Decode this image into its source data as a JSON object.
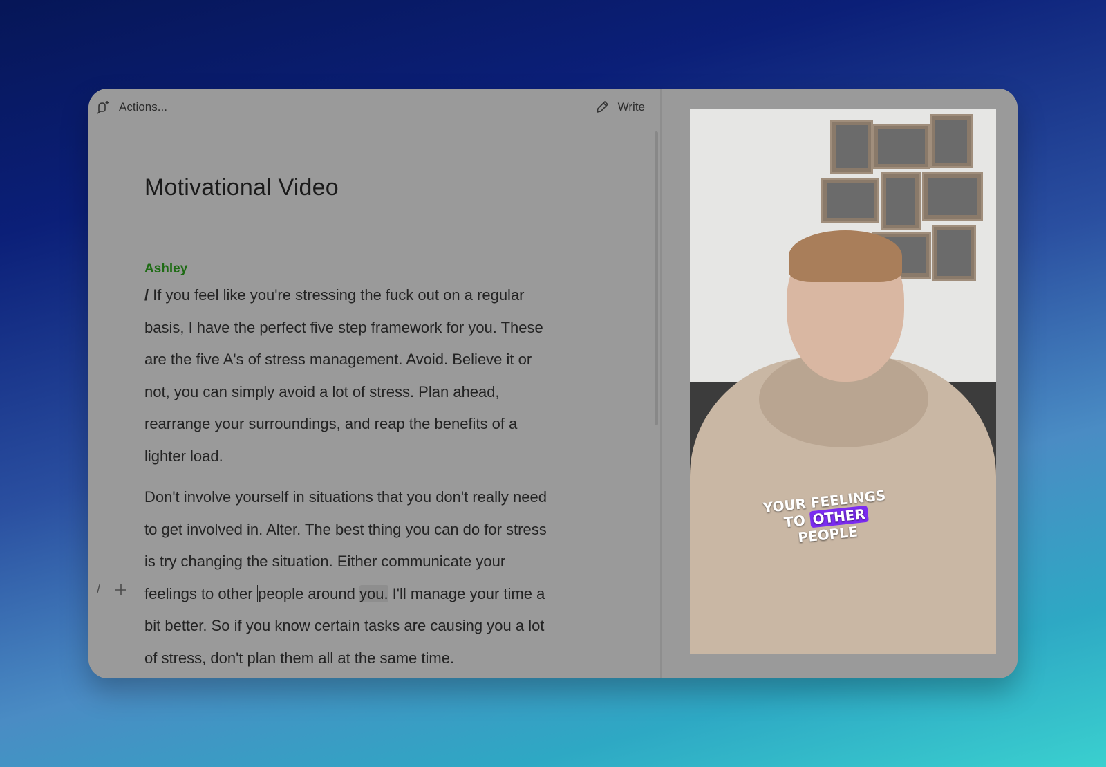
{
  "toolbar": {
    "actions_label": "Actions...",
    "actions_icon": "actions-sparkle-icon",
    "write_label": "Write",
    "write_icon": "pencil-icon"
  },
  "document": {
    "title": "Motivational Video",
    "speaker": "Ashley",
    "paragraph1": "If you feel like you're stressing the fuck out on a regular basis, I have the perfect five step framework for you. These are the five A's of stress management. Avoid. Believe it or not, you can simply avoid a lot of stress. Plan ahead, rearrange your surroundings, and reap the benefits of a lighter load.",
    "paragraph2_before_cursor": "Don't involve yourself in situations that you don't really need to get involved in. Alter. The best thing you can do for stress is try changing the situation. Either communicate your feelings to other ",
    "paragraph2_after_cursor": "people around ",
    "paragraph2_highlight": "you.",
    "paragraph2_rest": " I'll manage your time a bit better. So if you know certain tasks are causing you a lot of stress, don't plan them all at the same time.",
    "slash_marker": "/"
  },
  "gutter": {
    "slash": "/",
    "plus": "+"
  },
  "video": {
    "caption_line1": "YOUR FEELINGS",
    "caption_line2_pre": "TO",
    "caption_line2_accent": "OTHER",
    "caption_line2_post": "PEOPLE",
    "accent_color": "#7b2cf0"
  }
}
